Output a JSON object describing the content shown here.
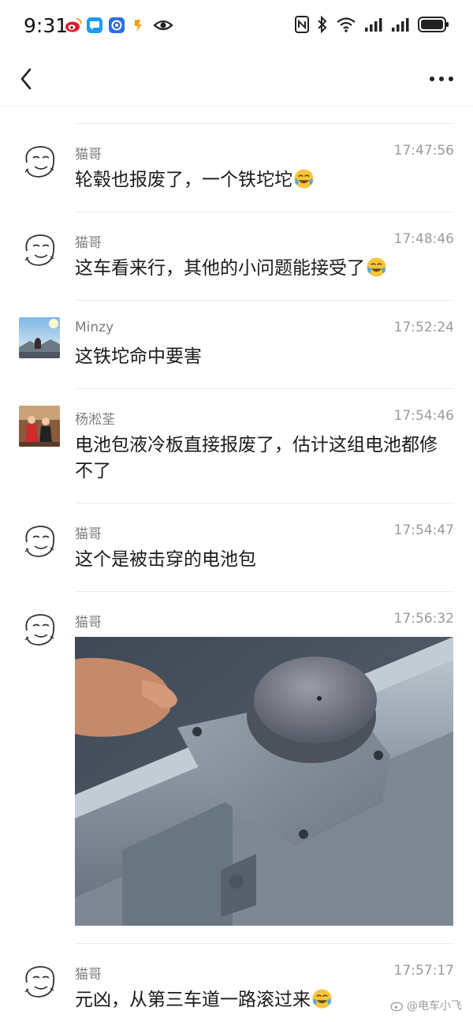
{
  "status_bar": {
    "time": "9:31"
  },
  "messages": [
    {
      "name": "猫哥",
      "time": "17:47:56",
      "text": "轮毂也报废了，一个铁坨坨",
      "emoji": "crying-laughing"
    },
    {
      "name": "猫哥",
      "time": "17:48:46",
      "text": "这车看来行，其他的小问题能接受了",
      "emoji": "crying-laughing"
    },
    {
      "name": "Minzy",
      "time": "17:52:24",
      "text": "这铁坨命中要害"
    },
    {
      "name": "杨淞荃",
      "time": "17:54:46",
      "text": "电池包液冷板直接报废了，估计这组电池都修不了"
    },
    {
      "name": "猫哥",
      "time": "17:54:47",
      "text": "这个是被击穿的电池包"
    },
    {
      "name": "猫哥",
      "time": "17:56:32",
      "image": "guardrail-photo"
    },
    {
      "name": "猫哥",
      "time": "17:57:17",
      "text": "元凶，从第三车道一路滚过来",
      "emoji": "crying-laughing"
    }
  ],
  "watermark": "@电车小飞"
}
